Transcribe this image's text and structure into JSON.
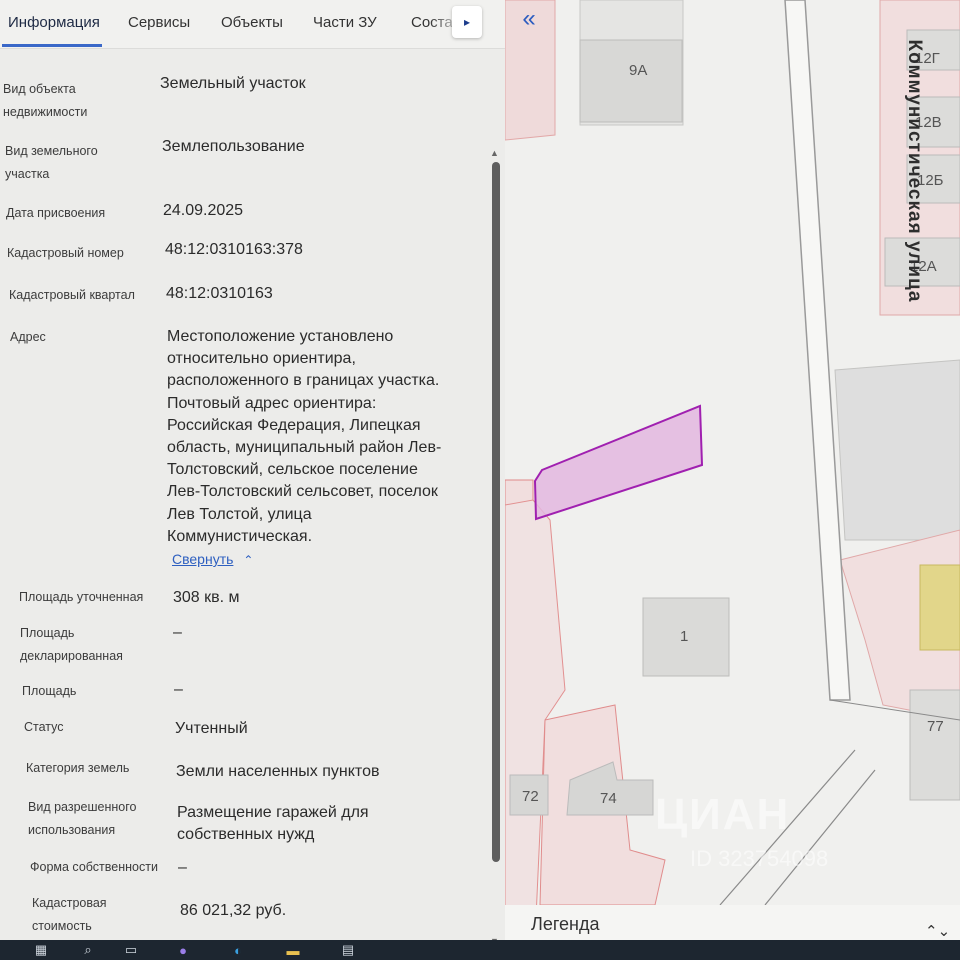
{
  "tabs": {
    "items": [
      "Информация",
      "Сервисы",
      "Объекты",
      "Части ЗУ",
      "Соста"
    ],
    "next_icon": "▸"
  },
  "fields": {
    "object_type": {
      "label": "Вид объекта недвижимости",
      "value": "Земельный участок"
    },
    "land_type": {
      "label": "Вид земельного участка",
      "value": "Землепользование"
    },
    "assign_date": {
      "label": "Дата присвоения",
      "value": "24.09.2025"
    },
    "cadastral_number": {
      "label": "Кадастровый номер",
      "value": "48:12:0310163:378"
    },
    "cadastral_block": {
      "label": "Кадастровый квартал",
      "value": "48:12:0310163"
    },
    "address": {
      "label": "Адрес",
      "value": "Местоположение установлено\nотносительно ориентира,\nрасположенного в границах участка.\nПочтовый адрес ориентира:\nРоссийская Федерация, Липецкая\nобласть, муниципальный район Лев-\nТолстовский, сельское поселение\nЛев-Толстовский сельсовет, поселок\nЛев Толстой, улица\nКоммунистическая.",
      "collapse_label": "Свернуть"
    },
    "area_refined": {
      "label": "Площадь уточненная",
      "value": "308 кв. м"
    },
    "area_declared": {
      "label": "Площадь декларированная",
      "value": "–"
    },
    "area": {
      "label": "Площадь",
      "value": "–"
    },
    "status": {
      "label": "Статус",
      "value": "Учтенный"
    },
    "land_category": {
      "label": "Категория земель",
      "value": "Земли населенных пунктов"
    },
    "permitted_use": {
      "label": "Вид разрешенного использования",
      "value": "Размещение гаражей для\nсобственных нужд"
    },
    "ownership_form": {
      "label": "Форма собственности",
      "value": "–"
    },
    "cadastral_value": {
      "label": "Кадастровая стоимость",
      "value": "86 021,32 руб."
    }
  },
  "map": {
    "collapse_icon": "«",
    "street_name": "Коммунистическая улица",
    "building_labels": [
      "9А",
      "12Г",
      "12В",
      "12Б",
      "12А",
      "1",
      "77",
      "72",
      "74"
    ],
    "legend_label": "Легенда",
    "legend_toggle": "⌃⌄",
    "watermark": "ЦИАН",
    "watermark_id": "ID 323754098",
    "selected_parcel_color": "#a020b0",
    "parcel_border_color": "#e0a0a0"
  },
  "taskbar": {
    "icons": [
      "windows-icon",
      "search-icon",
      "task-view-icon",
      "app-icon",
      "edge-icon",
      "files-icon",
      "store-icon"
    ]
  }
}
